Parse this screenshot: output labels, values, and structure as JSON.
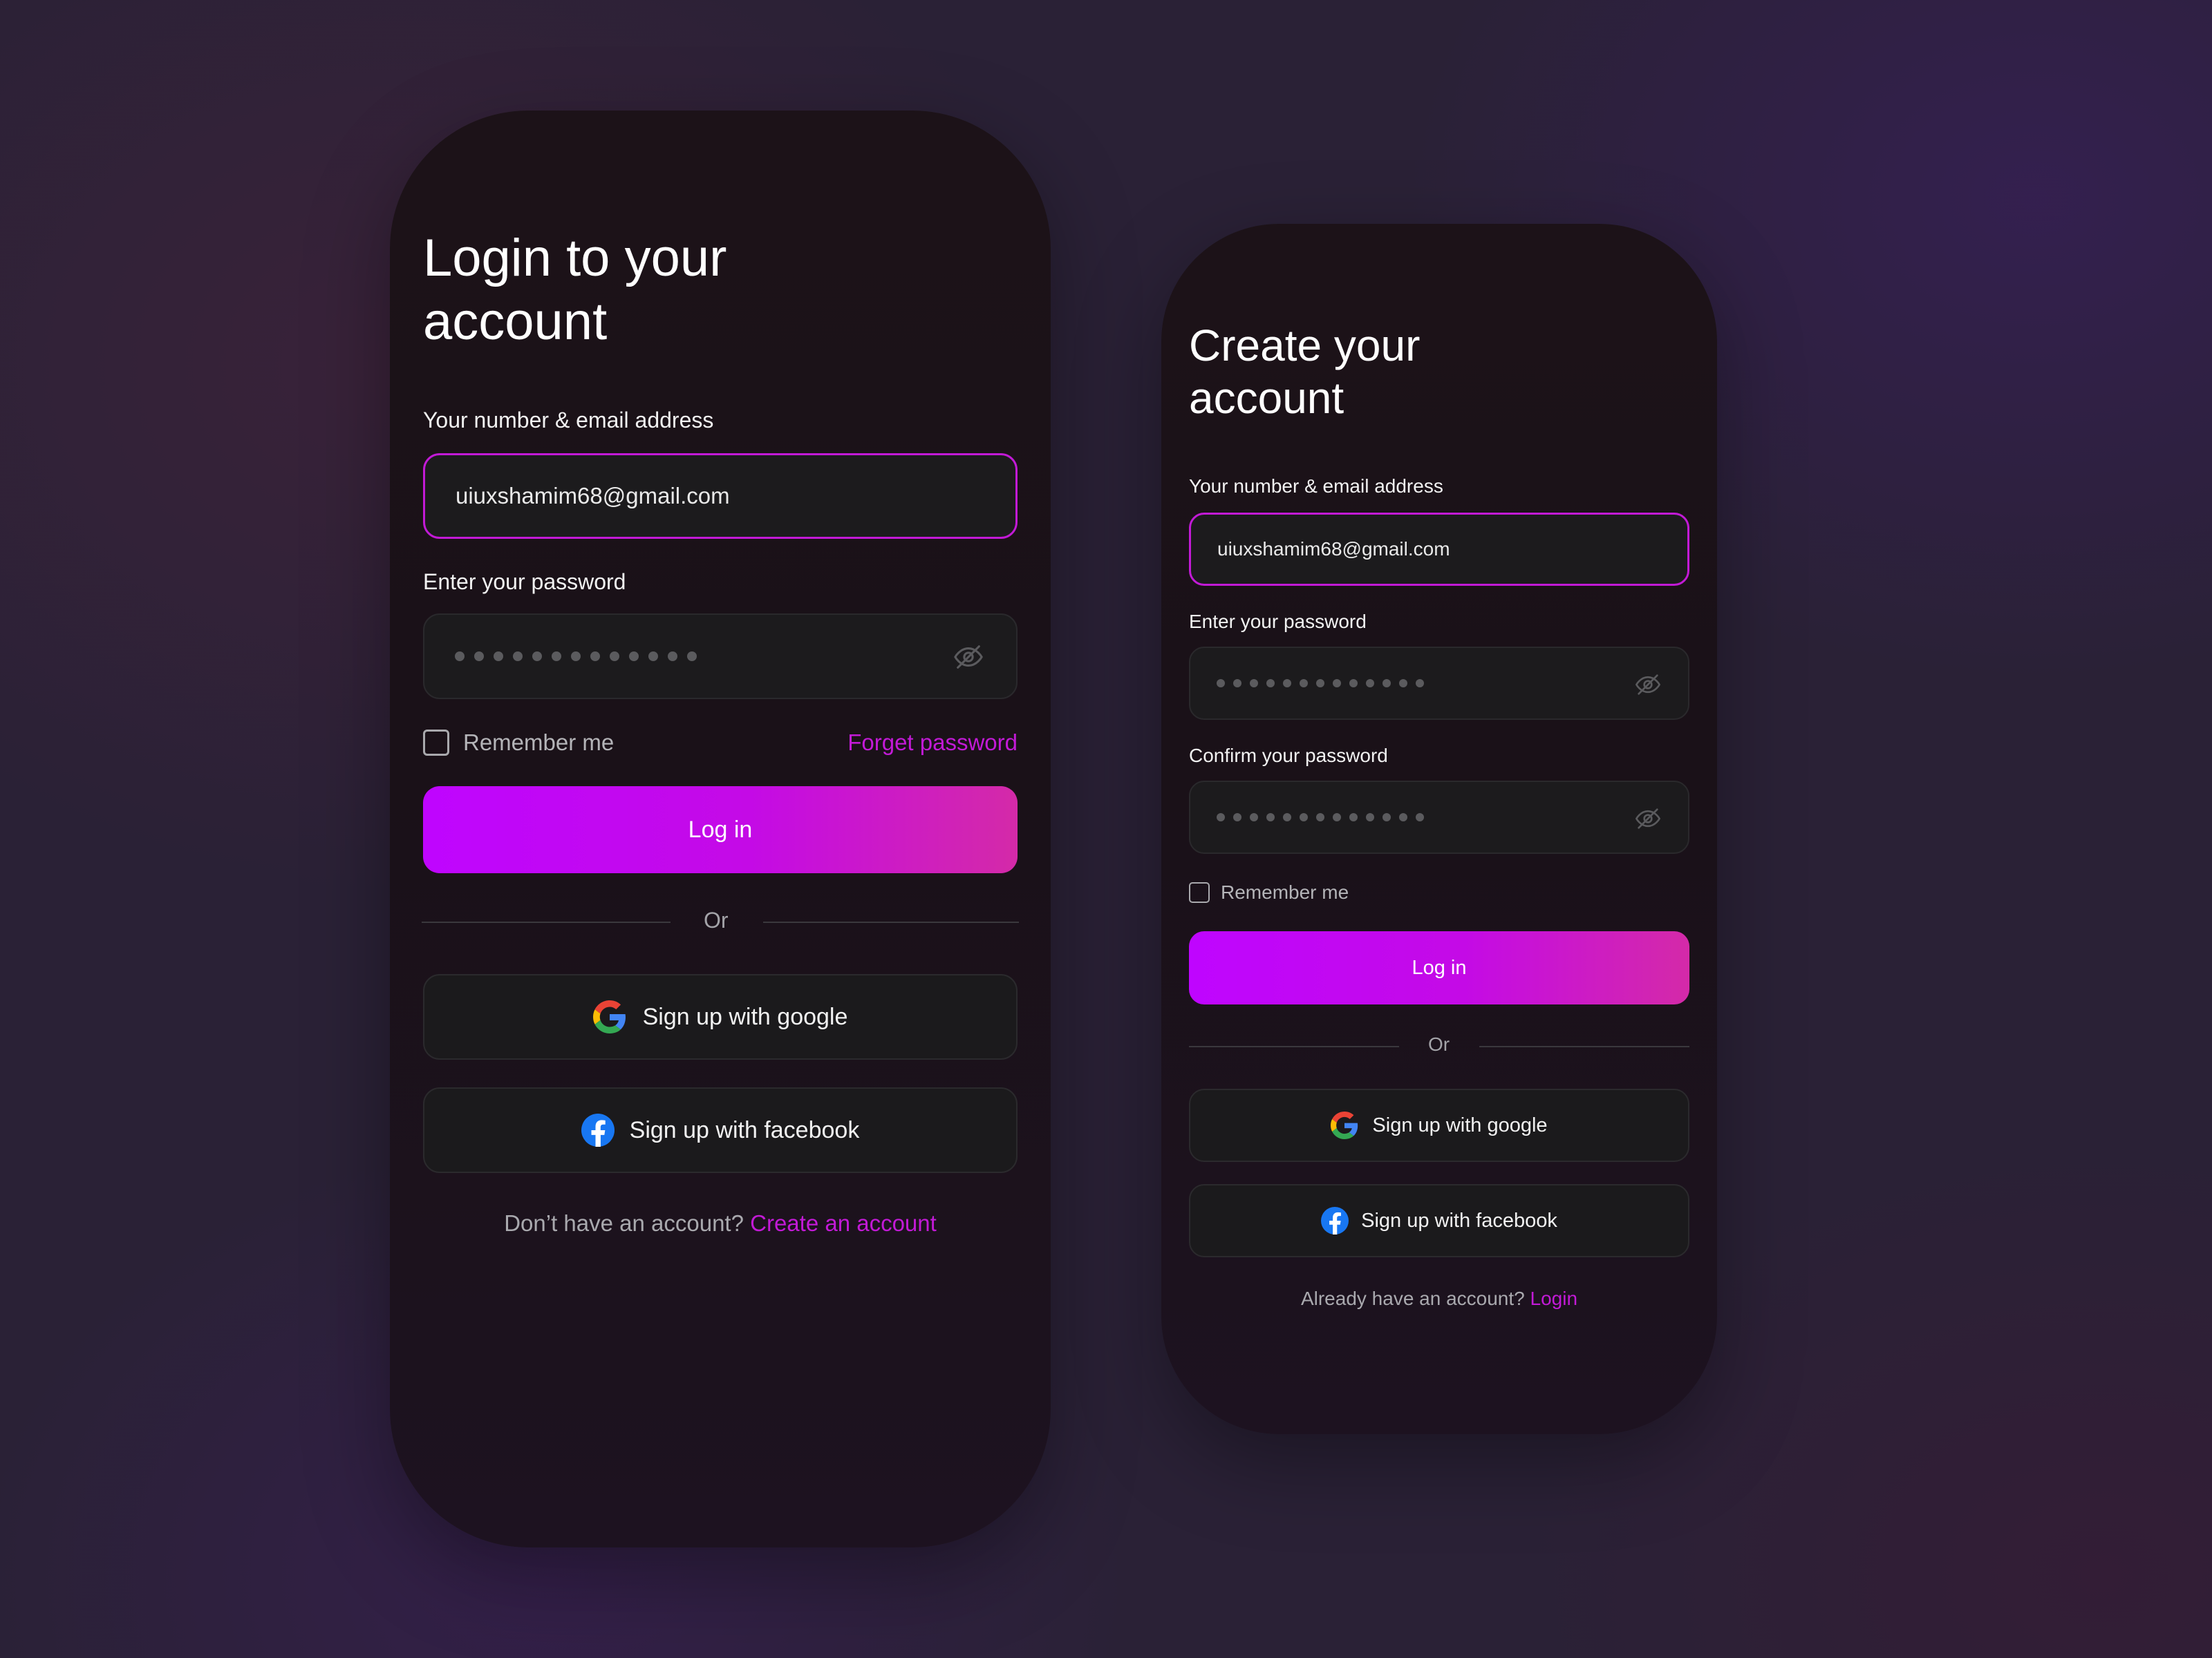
{
  "colors": {
    "accent": "#C21AD6",
    "button_gradient_start": "#BF05FF",
    "button_gradient_end": "#D42AA8",
    "card_bg": "#1A1118",
    "field_bg": "#1C1B1D"
  },
  "login_screen": {
    "title_line1": "Login to your",
    "title_line2": "account",
    "email_label": "Your number & email address",
    "email_value": "uiuxshamim68@gmail.com",
    "password_label": "Enter your password",
    "password_dot_count": 13,
    "remember_label": "Remember me",
    "forget_link": "Forget password",
    "login_button": "Log in",
    "divider_text": "Or",
    "google_button": "Sign up with google",
    "facebook_button": "Sign up with facebook",
    "footer_prompt": "Don’t have an account?",
    "footer_link": "Create an account"
  },
  "signup_screen": {
    "title_line1": "Create your",
    "title_line2": "account",
    "email_label": "Your number & email address",
    "email_value": "uiuxshamim68@gmail.com",
    "password_label": "Enter your password",
    "password_dot_count": 13,
    "confirm_label": "Confirm your password",
    "confirm_dot_count": 13,
    "remember_label": "Remember me",
    "login_button": "Log in",
    "divider_text": "Or",
    "google_button": "Sign up with google",
    "facebook_button": "Sign up with facebook",
    "footer_prompt": "Already have an account?",
    "footer_link": "Login"
  },
  "icons": {
    "password_toggle": "eye-off-icon",
    "google": "google-g-icon",
    "facebook": "facebook-f-icon"
  }
}
